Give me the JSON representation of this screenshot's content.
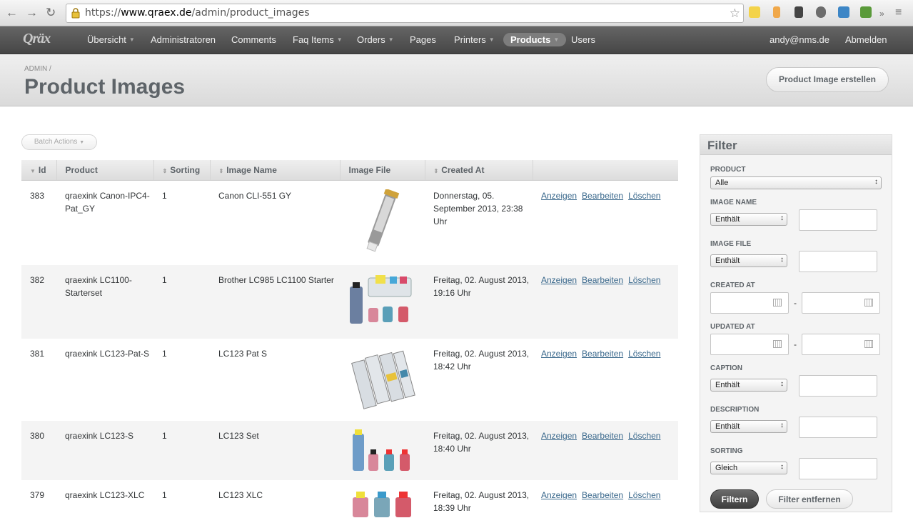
{
  "browser": {
    "url_prefix": "https://",
    "url_host": "www.qraex.de",
    "url_path": "/admin/product_images"
  },
  "nav": {
    "logo": "Qräx",
    "items": [
      {
        "label": "Übersicht",
        "caret": true
      },
      {
        "label": "Administratoren",
        "caret": false
      },
      {
        "label": "Comments",
        "caret": false
      },
      {
        "label": "Faq Items",
        "caret": true
      },
      {
        "label": "Orders",
        "caret": true
      },
      {
        "label": "Pages",
        "caret": false
      },
      {
        "label": "Printers",
        "caret": true
      },
      {
        "label": "Products",
        "caret": true
      },
      {
        "label": "Users",
        "caret": false
      }
    ],
    "user": "andy@nms.de",
    "logout": "Abmelden"
  },
  "header": {
    "breadcrumb": "ADMIN",
    "separator": "/",
    "title": "Product Images",
    "create_button": "Product Image erstellen"
  },
  "batch_actions": "Batch Actions",
  "table": {
    "columns": [
      "Id",
      "Product",
      "Sorting",
      "Image Name",
      "Image File",
      "Created At",
      ""
    ],
    "action_labels": [
      "Anzeigen",
      "Bearbeiten",
      "Löschen"
    ],
    "rows": [
      {
        "id": "383",
        "product": "qraexink Canon-IPC4-Pat_GY",
        "sorting": "1",
        "image_name": "Canon CLI-551 GY",
        "created": "Donnerstag, 05. September 2013, 23:38 Uhr",
        "image": "cartridge"
      },
      {
        "id": "382",
        "product": "qraexink LC1100-Starterset",
        "sorting": "1",
        "image_name": "Brother LC985 LC1100 Starter",
        "created": "Freitag, 02. August 2013, 19:16 Uhr",
        "image": "starterset"
      },
      {
        "id": "381",
        "product": "qraexink LC123-Pat-S",
        "sorting": "1",
        "image_name": "LC123 Pat S",
        "created": "Freitag, 02. August 2013, 18:42 Uhr",
        "image": "cartridges"
      },
      {
        "id": "380",
        "product": "qraexink LC123-S",
        "sorting": "1",
        "image_name": "LC123 Set",
        "created": "Freitag, 02. August 2013, 18:40 Uhr",
        "image": "bottles"
      },
      {
        "id": "379",
        "product": "qraexink LC123-XLC",
        "sorting": "1",
        "image_name": "LC123 XLC",
        "created": "Freitag, 02. August 2013, 18:39 Uhr",
        "image": "bottles2"
      }
    ]
  },
  "filter": {
    "title": "Filter",
    "product_label": "PRODUCT",
    "product_value": "Alle",
    "image_name_label": "IMAGE NAME",
    "image_file_label": "IMAGE FILE",
    "created_label": "CREATED AT",
    "updated_label": "UPDATED AT",
    "caption_label": "CAPTION",
    "description_label": "DESCRIPTION",
    "sorting_label": "SORTING",
    "contains": "Enthält",
    "equals": "Gleich",
    "dash": "-",
    "apply": "Filtern",
    "clear": "Filter entfernen"
  }
}
